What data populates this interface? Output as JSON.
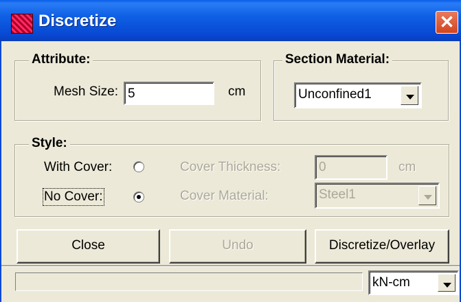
{
  "window": {
    "title": "Discretize",
    "close_symbol": "✕"
  },
  "attribute": {
    "legend": "Attribute:",
    "mesh_size_label": "Mesh Size:",
    "mesh_size_value": "5",
    "mesh_size_unit": "cm"
  },
  "section_material": {
    "legend": "Section Material:",
    "selected": "Unconfined1"
  },
  "style": {
    "legend": "Style:",
    "with_cover_label": "With Cover:",
    "no_cover_label": "No Cover:",
    "selected_option": "No Cover",
    "cover_thickness_label": "Cover Thickness:",
    "cover_thickness_value": "0",
    "cover_thickness_unit": "cm",
    "cover_material_label": "Cover Material:",
    "cover_material_selected": "Steel1"
  },
  "buttons": {
    "close": "Close",
    "undo": "Undo",
    "discretize": "Discretize/Overlay"
  },
  "statusbar": {
    "units_selected": "kN-cm"
  }
}
